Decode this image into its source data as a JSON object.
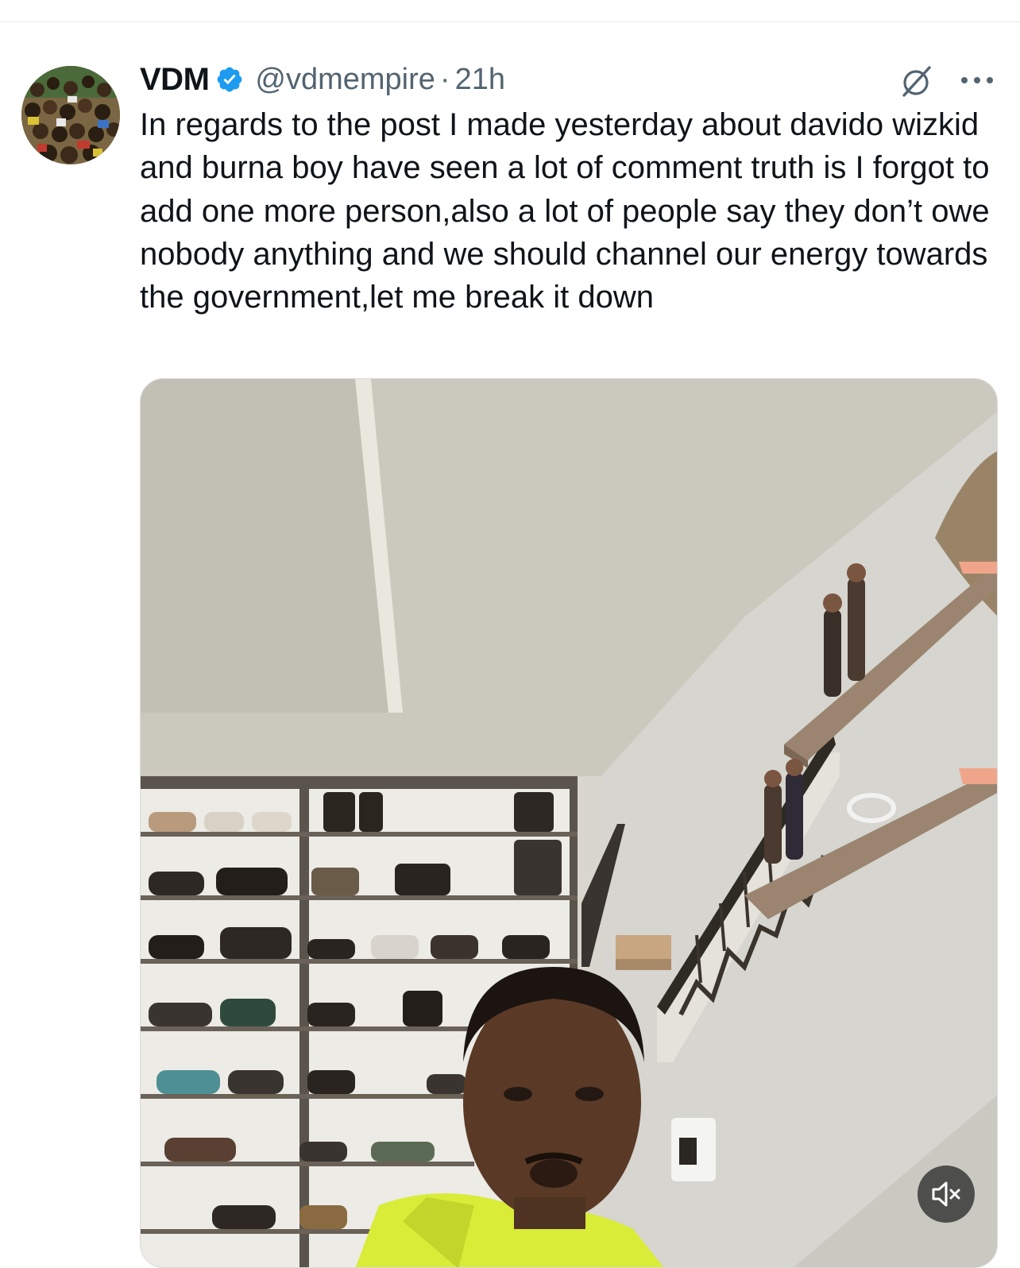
{
  "tweet": {
    "author_name": "VDM",
    "handle": "@vdmempire",
    "separator": "·",
    "time": "21h",
    "verified": true,
    "text": "In regards to the post I made yesterday about davido wizkid and burna boy have seen a lot of comment truth is I forgot to add one more person,also a lot of people say they don’t owe nobody anything and we should channel our energy towards the government,let me break it down"
  },
  "icons": {
    "verified": "verified-badge-icon",
    "grok": "grok-icon",
    "more": "more-options-icon",
    "mute": "muted-speaker-icon"
  },
  "colors": {
    "verified_blue": "#1d9bf0",
    "text_primary": "#0f1419",
    "text_secondary": "#536471"
  }
}
